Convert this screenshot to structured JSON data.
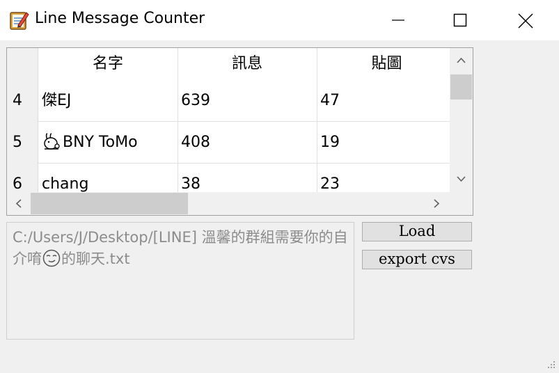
{
  "window": {
    "title": "Line Message Counter",
    "icon": "notepad-app-icon"
  },
  "table": {
    "columns": [
      "名字",
      "訊息",
      "貼圖"
    ],
    "rows": [
      {
        "index": "4",
        "name": "傑EJ",
        "messages": "639",
        "stickers": "47"
      },
      {
        "index": "5",
        "name": "BNY ToMo",
        "name_icon": "rabbit-icon",
        "messages": "408",
        "stickers": "19"
      },
      {
        "index": "6",
        "name": "chang",
        "messages": "38",
        "stickers": "23"
      }
    ]
  },
  "file_path": {
    "text_before_icon": "C:/Users/J/Desktop/[LINE] 溫馨的群組需要你的自介唷",
    "icon": "smirk-emoji-icon",
    "text_after_icon": "的聊天.txt"
  },
  "buttons": {
    "load": "Load",
    "export": "export cvs"
  },
  "colors": {
    "titlebar": "#ffffff",
    "window_bg": "#f0f0f0",
    "scroll_thumb": "#cdcdcd",
    "path_text": "#8c8c8c"
  }
}
